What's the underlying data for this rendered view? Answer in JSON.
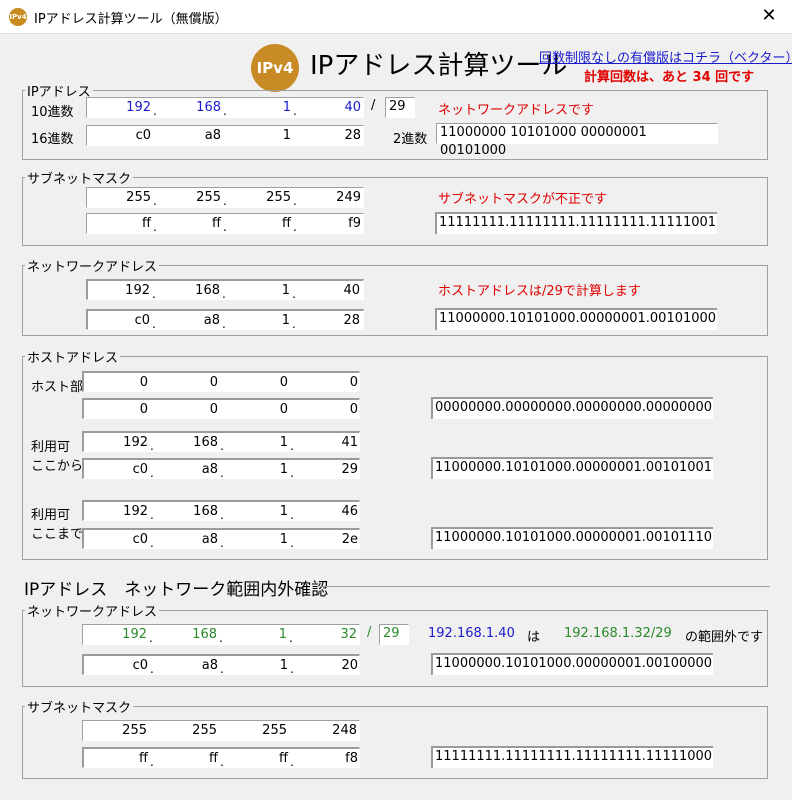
{
  "window": {
    "title": "IPアドレス計算ツール（無償版）",
    "icon_text": "IPv4",
    "close": "✕"
  },
  "header": {
    "logo_text": "IPv4",
    "heading": "IPアドレス計算ツール",
    "paid_link": "回数制限なしの有償版はコチラ（ベクター）",
    "remaining": "計算回数は、あと 34  回です"
  },
  "ip": {
    "legend": "IPアドレス",
    "dec_label": "10進数",
    "hex_label": "16進数",
    "bin_label": "2進数",
    "dec": [
      "192",
      "168",
      "1",
      "40"
    ],
    "hex": [
      "c0",
      "a8",
      "1",
      "28"
    ],
    "slash": "/",
    "prefix": "29",
    "binary": "11000000  10101000  00000001  00101000",
    "message": "ネットワークアドレスです"
  },
  "subnet": {
    "legend": "サブネットマスク",
    "dec": [
      "255",
      "255",
      "255",
      "249"
    ],
    "hex": [
      "ff",
      "ff",
      "ff",
      "f9"
    ],
    "binary": "11111111.11111111.11111111.11111001",
    "message": "サブネットマスクが不正です"
  },
  "network": {
    "legend": "ネットワークアドレス",
    "dec": [
      "192",
      "168",
      "1",
      "40"
    ],
    "hex": [
      "c0",
      "a8",
      "1",
      "28"
    ],
    "binary": "11000000.10101000.00000001.00101000",
    "message": "ホストアドレスは/29で計算します"
  },
  "host": {
    "legend": "ホストアドレス",
    "host_label": "ホスト部",
    "from_label1": "利用可",
    "from_label2": "ここから",
    "to_label1": "利用可",
    "to_label2": "ここまで",
    "host_dec": [
      "0",
      "0",
      "0",
      "0"
    ],
    "host_hex": [
      "0",
      "0",
      "0",
      "0"
    ],
    "host_binary": "00000000.00000000.00000000.00000000",
    "from_dec": [
      "192",
      "168",
      "1",
      "41"
    ],
    "from_hex": [
      "c0",
      "a8",
      "1",
      "29"
    ],
    "from_binary": "11000000.10101000.00000001.00101001",
    "to_dec": [
      "192",
      "168",
      "1",
      "46"
    ],
    "to_hex": [
      "c0",
      "a8",
      "1",
      "2e"
    ],
    "to_binary": "11000000.10101000.00000001.00101110"
  },
  "range": {
    "title": "IPアドレス　ネットワーク範囲内外確認",
    "net_legend": "ネットワークアドレス",
    "net_dec": [
      "192",
      "168",
      "1",
      "32"
    ],
    "net_hex": [
      "c0",
      "a8",
      "1",
      "20"
    ],
    "slash": "/",
    "prefix": "29",
    "binary": "11000000.10101000.00000001.00100000",
    "msg_ip": "192.168.1.40",
    "msg_wa": "は",
    "msg_net": "192.168.1.32/29",
    "msg_tail": "の範囲外です",
    "mask_legend": "サブネットマスク",
    "mask_dec": [
      "255",
      "255",
      "255",
      "248"
    ],
    "mask_hex": [
      "ff",
      "ff",
      "ff",
      "f8"
    ],
    "mask_binary": "11111111.11111111.11111111.11111000"
  },
  "dot": ".",
  "colors": {
    "accent": "#c88a24",
    "error": "#e00000",
    "link": "#1a1acc",
    "ok": "#2a8a2a"
  }
}
